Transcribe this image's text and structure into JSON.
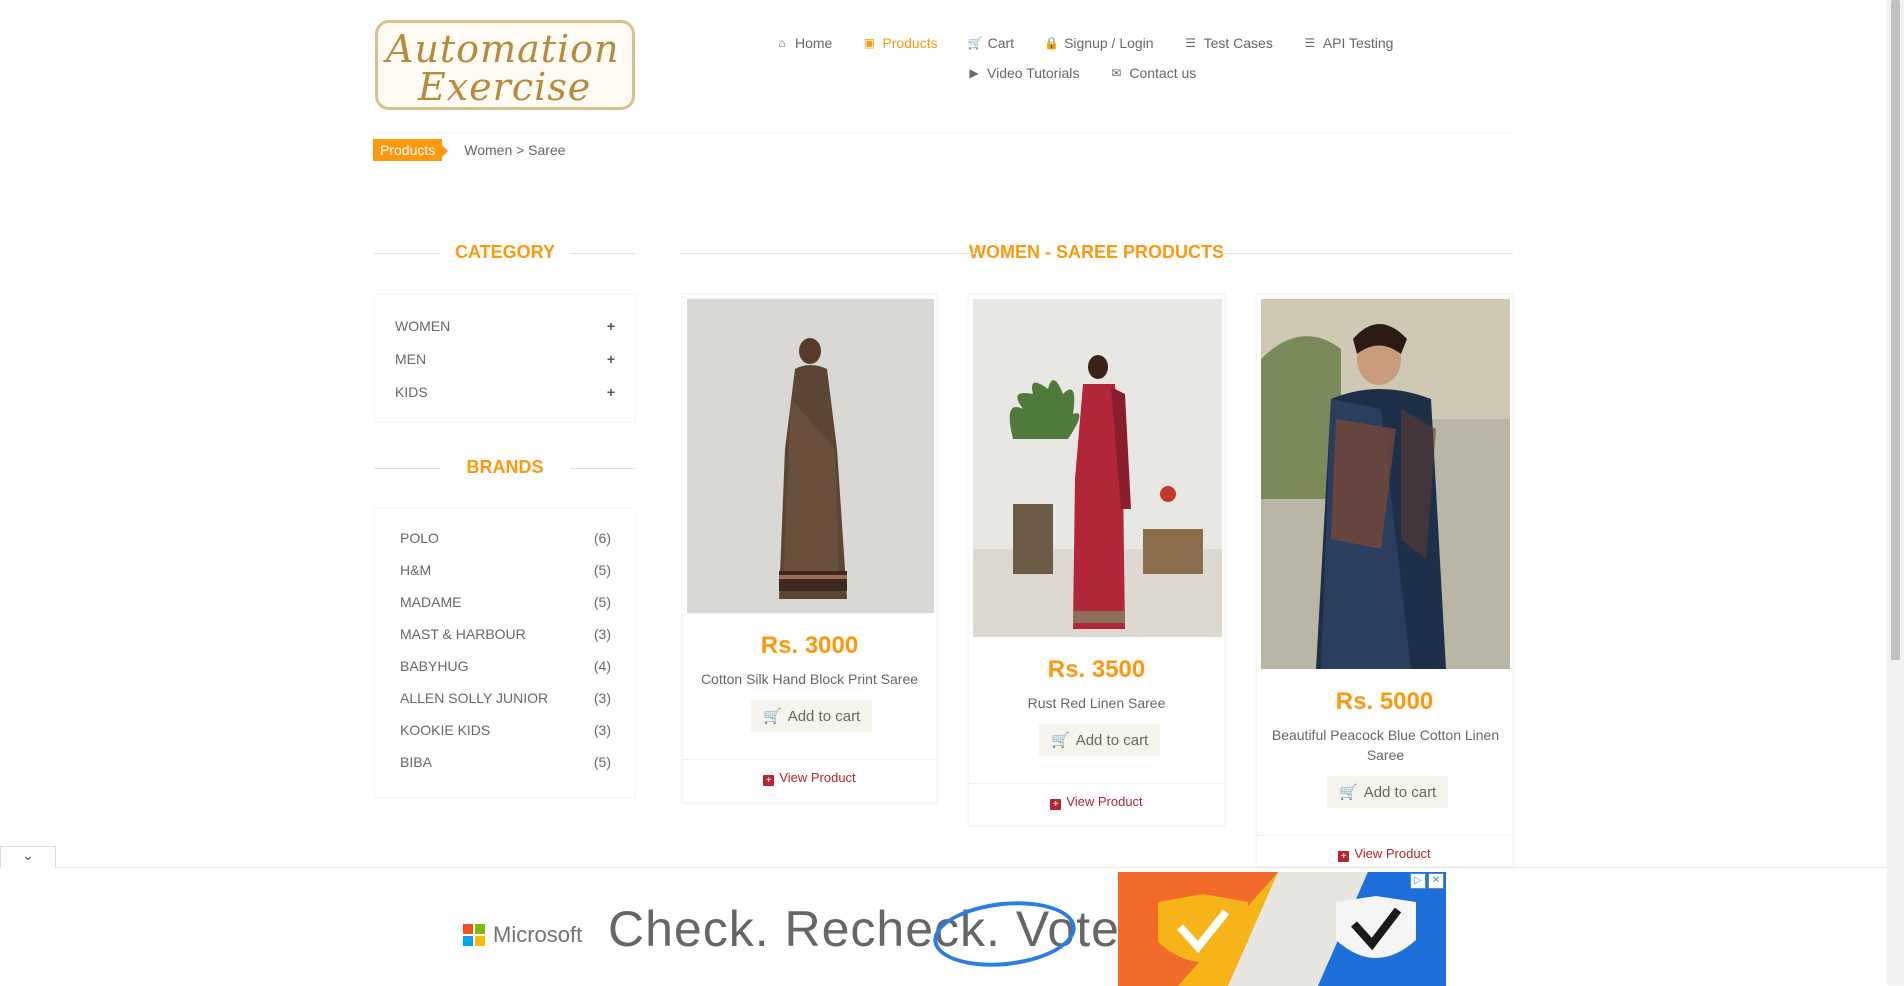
{
  "logo": {
    "line1": "Automation",
    "line2": "Exercise"
  },
  "nav": {
    "row1": [
      {
        "label": "Home",
        "icon": "home-icon",
        "glyph": "⌂",
        "active": false
      },
      {
        "label": "Products",
        "icon": "products-icon",
        "glyph": "▣",
        "active": true
      },
      {
        "label": "Cart",
        "icon": "cart-icon",
        "glyph": "🛒",
        "active": false
      },
      {
        "label": "Signup / Login",
        "icon": "lock-icon",
        "glyph": "🔒",
        "active": false
      },
      {
        "label": "Test Cases",
        "icon": "list-icon",
        "glyph": "☰",
        "active": false
      },
      {
        "label": "API Testing",
        "icon": "list-icon",
        "glyph": "☰",
        "active": false
      }
    ],
    "row2": [
      {
        "label": "Video Tutorials",
        "icon": "youtube-icon",
        "glyph": "▶",
        "active": false
      },
      {
        "label": "Contact us",
        "icon": "envelope-icon",
        "glyph": "✉",
        "active": false
      }
    ]
  },
  "breadcrumb": {
    "tag": "Products",
    "path": "Women > Saree"
  },
  "sidebar": {
    "category_title": "CATEGORY",
    "categories": [
      {
        "label": "Women",
        "toggle": "+"
      },
      {
        "label": "Men",
        "toggle": "+"
      },
      {
        "label": "Kids",
        "toggle": "+"
      }
    ],
    "brands_title": "BRANDS",
    "brands": [
      {
        "name": "POLO",
        "count": "(6)"
      },
      {
        "name": "H&M",
        "count": "(5)"
      },
      {
        "name": "MADAME",
        "count": "(5)"
      },
      {
        "name": "MAST & HARBOUR",
        "count": "(3)"
      },
      {
        "name": "BABYHUG",
        "count": "(4)"
      },
      {
        "name": "ALLEN SOLLY JUNIOR",
        "count": "(3)"
      },
      {
        "name": "KOOKIE KIDS",
        "count": "(3)"
      },
      {
        "name": "BIBA",
        "count": "(5)"
      }
    ]
  },
  "main": {
    "title": "WOMEN - SAREE PRODUCTS",
    "products": [
      {
        "price": "Rs. 3000",
        "name": "Cotton Silk Hand Block Print Saree",
        "add": "Add to cart",
        "view": "View Product"
      },
      {
        "price": "Rs. 3500",
        "name": "Rust Red Linen Saree",
        "add": "Add to cart",
        "view": "View Product"
      },
      {
        "price": "Rs. 5000",
        "name": "Beautiful Peacock Blue Cotton Linen Saree",
        "add": "Add to cart",
        "view": "View Product"
      }
    ]
  },
  "ad": {
    "brand": "Microsoft",
    "slogan": "Check. Recheck. Vote."
  },
  "colors": {
    "accent": "#FE980F",
    "link": "#B3272D",
    "text": "#696763"
  }
}
